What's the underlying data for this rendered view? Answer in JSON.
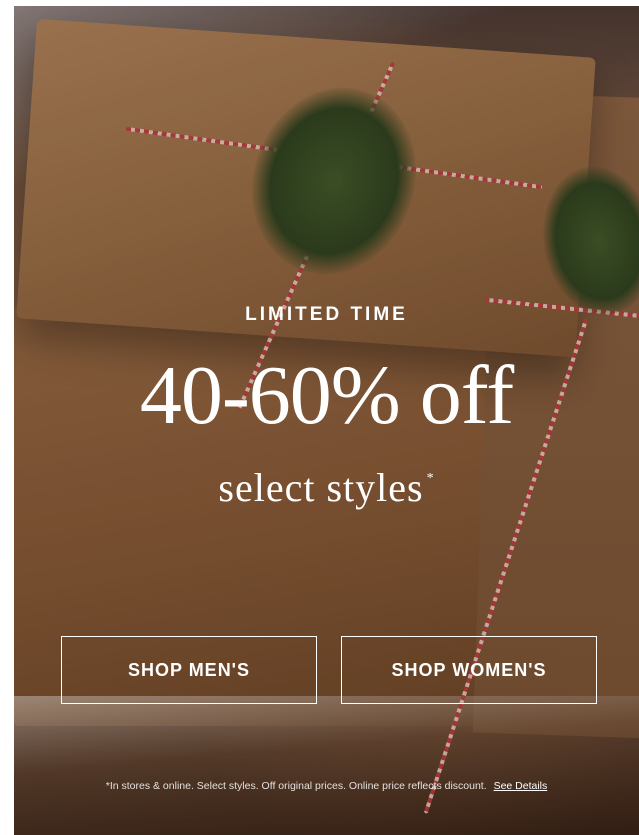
{
  "hero": {
    "eyebrow": "LIMITED TIME",
    "headline": "40-60% off",
    "subhead": "select styles",
    "subhead_mark": "*"
  },
  "buttons": {
    "men_label": "SHOP MEN'S",
    "women_label": "SHOP WOMEN'S"
  },
  "disclaimer": {
    "text": "*In stores & online. Select styles. Off original prices. Online price reflects discount.",
    "link_label": "See Details"
  },
  "colors": {
    "text": "#ffffff",
    "background": "#8a6447"
  }
}
